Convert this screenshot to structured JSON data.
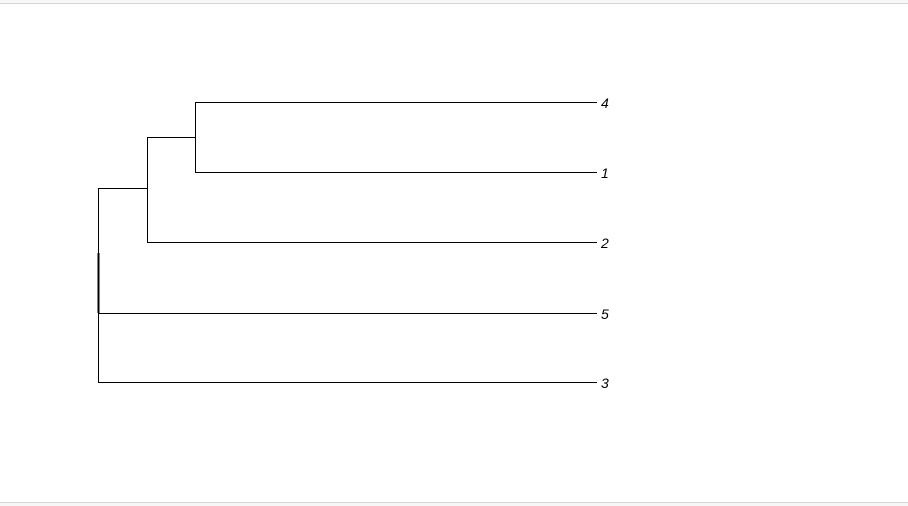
{
  "tree": {
    "type": "phylogram",
    "tips": [
      "4",
      "1",
      "2",
      "5",
      "3"
    ],
    "label_style": "italic"
  }
}
